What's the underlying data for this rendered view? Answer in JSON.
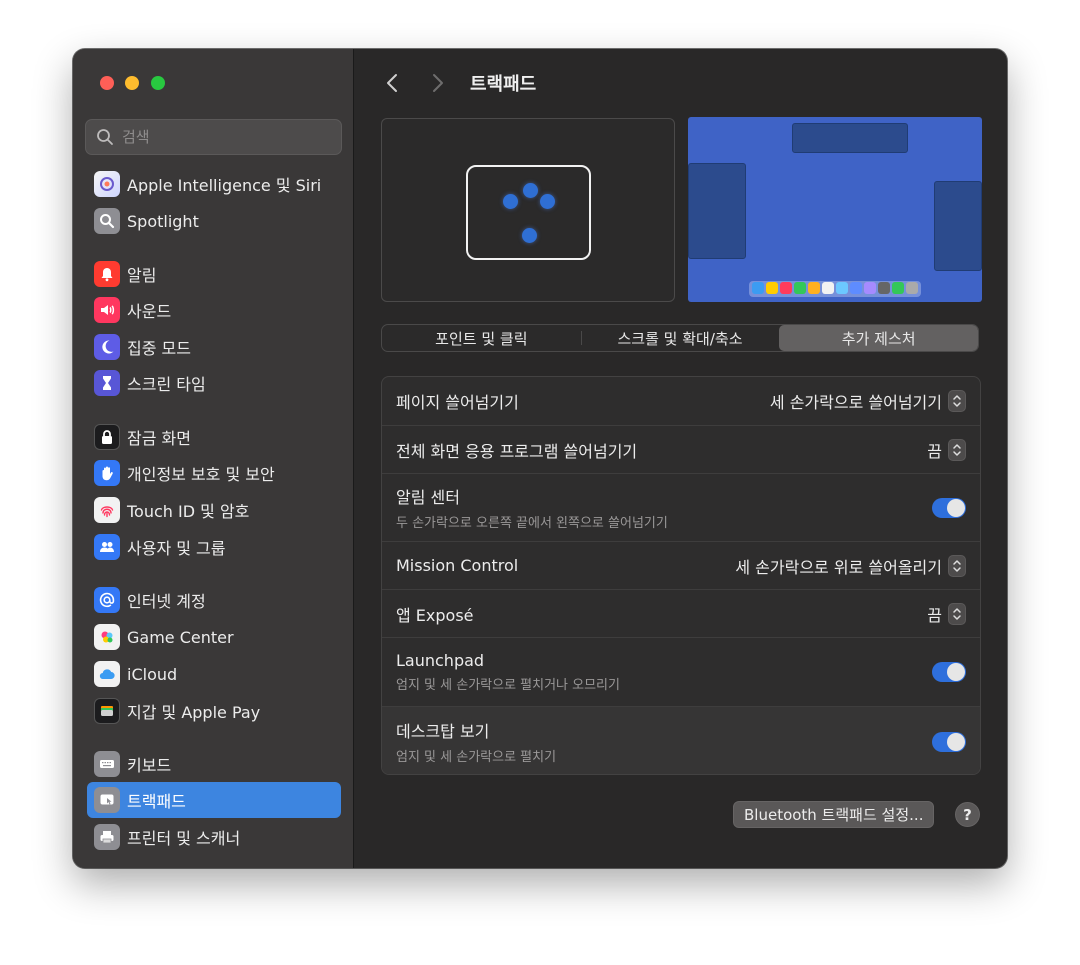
{
  "search": {
    "placeholder": "검색"
  },
  "sidebar": {
    "items": [
      {
        "label": "Apple Intelligence 및 Siri",
        "icon": "apple-intelligence-icon",
        "color": "#d8d8e8"
      },
      {
        "label": "Spotlight",
        "icon": "spotlight-icon",
        "color": "#8e8e93"
      },
      {
        "label": "알림",
        "icon": "notifications-icon",
        "color": "#ff3b30"
      },
      {
        "label": "사운드",
        "icon": "sound-icon",
        "color": "#ff375f"
      },
      {
        "label": "집중 모드",
        "icon": "focus-icon",
        "color": "#5e5ce6"
      },
      {
        "label": "스크린 타임",
        "icon": "screen-time-icon",
        "color": "#5856d6"
      },
      {
        "label": "잠금 화면",
        "icon": "lock-icon",
        "color": "#1c1c1e"
      },
      {
        "label": "개인정보 보호 및 보안",
        "icon": "privacy-hand-icon",
        "color": "#3478f6"
      },
      {
        "label": "Touch ID 및 암호",
        "icon": "fingerprint-icon",
        "color": "#f2f2f2"
      },
      {
        "label": "사용자 및 그룹",
        "icon": "users-icon",
        "color": "#3478f6"
      },
      {
        "label": "인터넷 계정",
        "icon": "at-icon",
        "color": "#3478f6"
      },
      {
        "label": "Game Center",
        "icon": "game-center-icon",
        "color": "#f2f2f2"
      },
      {
        "label": "iCloud",
        "icon": "icloud-icon",
        "color": "#f2f2f2"
      },
      {
        "label": "지갑 및 Apple Pay",
        "icon": "wallet-icon",
        "color": "#1c1c1e"
      },
      {
        "label": "키보드",
        "icon": "keyboard-icon",
        "color": "#8e8e93"
      },
      {
        "label": "트랙패드",
        "icon": "trackpad-icon",
        "color": "#8e8e93"
      },
      {
        "label": "프린터 및 스캐너",
        "icon": "printer-icon",
        "color": "#8e8e93"
      }
    ],
    "selected": "트랙패드"
  },
  "header": {
    "title": "트랙패드"
  },
  "tabs": [
    {
      "label": "포인트 및 클릭"
    },
    {
      "label": "스크롤 및 확대/축소"
    },
    {
      "label": "추가 제스처"
    }
  ],
  "active_tab": "추가 제스처",
  "settings": [
    {
      "label": "페이지 쓸어넘기기",
      "value": "세 손가락으로 쓸어넘기기",
      "control": "popup"
    },
    {
      "label": "전체 화면 응용 프로그램 쓸어넘기기",
      "value": "끔",
      "control": "popup"
    },
    {
      "label": "알림 센터",
      "sub": "두 손가락으로 오른쪽 끝에서 왼쪽으로 쓸어넘기기",
      "control": "toggle",
      "on": true
    },
    {
      "label": "Mission Control",
      "value": "세 손가락으로 위로 쓸어올리기",
      "control": "popup"
    },
    {
      "label": "앱 Exposé",
      "value": "끔",
      "control": "popup"
    },
    {
      "label": "Launchpad",
      "sub": "엄지 및 세 손가락으로 펼치거나 오므리기",
      "control": "toggle",
      "on": true
    },
    {
      "label": "데스크탑 보기",
      "sub": "엄지 및 세 손가락으로 펼치기",
      "control": "toggle",
      "on": true
    }
  ],
  "footer": {
    "bluetooth_button": "Bluetooth 트랙패드 설정...",
    "help": "?"
  },
  "colors": {
    "accent": "#3d85e0",
    "toggle_on": "#2e6fdc",
    "window_bg": "#292828",
    "sidebar_bg": "#3a3838"
  }
}
